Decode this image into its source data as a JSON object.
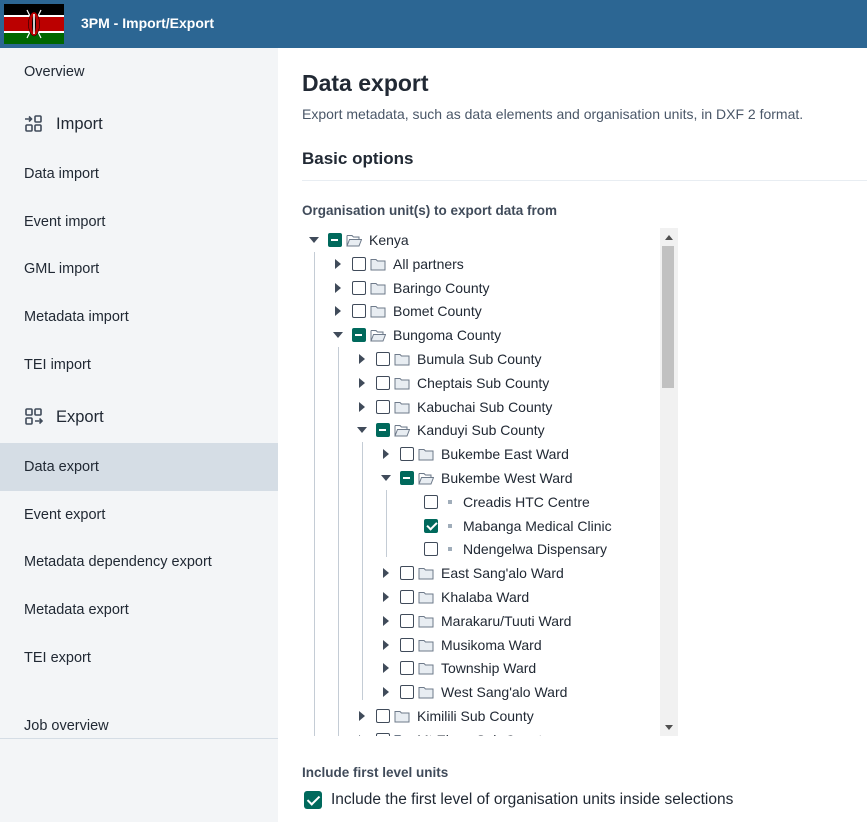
{
  "header": {
    "title": "3PM - Import/Export"
  },
  "sidebar": {
    "overview": "Overview",
    "import_section": "Import",
    "import_items": [
      "Data import",
      "Event import",
      "GML import",
      "Metadata import",
      "TEI import"
    ],
    "export_section": "Export",
    "export_items": [
      "Data export",
      "Event export",
      "Metadata dependency export",
      "Metadata export",
      "TEI export"
    ],
    "job_overview": "Job overview",
    "active_item": "Data export"
  },
  "main": {
    "title": "Data export",
    "description": "Export metadata, such as data elements and organisation units, in DXF 2 format.",
    "section_title": "Basic options",
    "org_unit_label": "Organisation unit(s) to export data from",
    "first_level_label": "Include first level units",
    "first_level_checkbox_label": "Include the first level of organisation units inside selections",
    "first_level_checked": true
  },
  "tree": [
    {
      "label": "Kenya",
      "level": 0,
      "expanded": true,
      "state": "partial",
      "type": "folder"
    },
    {
      "label": "All partners",
      "level": 1,
      "expanded": false,
      "state": "unchecked",
      "type": "folder"
    },
    {
      "label": "Baringo County",
      "level": 1,
      "expanded": false,
      "state": "unchecked",
      "type": "folder"
    },
    {
      "label": "Bomet County",
      "level": 1,
      "expanded": false,
      "state": "unchecked",
      "type": "folder"
    },
    {
      "label": "Bungoma County",
      "level": 1,
      "expanded": true,
      "state": "partial",
      "type": "folder"
    },
    {
      "label": "Bumula Sub County",
      "level": 2,
      "expanded": false,
      "state": "unchecked",
      "type": "folder"
    },
    {
      "label": "Cheptais Sub County",
      "level": 2,
      "expanded": false,
      "state": "unchecked",
      "type": "folder"
    },
    {
      "label": "Kabuchai Sub County",
      "level": 2,
      "expanded": false,
      "state": "unchecked",
      "type": "folder"
    },
    {
      "label": "Kanduyi Sub County",
      "level": 2,
      "expanded": true,
      "state": "partial",
      "type": "folder"
    },
    {
      "label": "Bukembe East Ward",
      "level": 3,
      "expanded": false,
      "state": "unchecked",
      "type": "folder"
    },
    {
      "label": "Bukembe West Ward",
      "level": 3,
      "expanded": true,
      "state": "partial",
      "type": "folder"
    },
    {
      "label": "Creadis HTC Centre",
      "level": 4,
      "state": "unchecked",
      "type": "leaf"
    },
    {
      "label": "Mabanga Medical Clinic",
      "level": 4,
      "state": "checked",
      "type": "leaf"
    },
    {
      "label": "Ndengelwa Dispensary",
      "level": 4,
      "state": "unchecked",
      "type": "leaf"
    },
    {
      "label": "East Sang'alo Ward",
      "level": 3,
      "expanded": false,
      "state": "unchecked",
      "type": "folder"
    },
    {
      "label": "Khalaba Ward",
      "level": 3,
      "expanded": false,
      "state": "unchecked",
      "type": "folder"
    },
    {
      "label": "Marakaru/Tuuti Ward",
      "level": 3,
      "expanded": false,
      "state": "unchecked",
      "type": "folder"
    },
    {
      "label": "Musikoma Ward",
      "level": 3,
      "expanded": false,
      "state": "unchecked",
      "type": "folder"
    },
    {
      "label": "Township Ward",
      "level": 3,
      "expanded": false,
      "state": "unchecked",
      "type": "folder"
    },
    {
      "label": "West Sang'alo Ward",
      "level": 3,
      "expanded": false,
      "state": "unchecked",
      "type": "folder"
    },
    {
      "label": "Kimilili Sub County",
      "level": 2,
      "expanded": false,
      "state": "unchecked",
      "type": "folder"
    },
    {
      "label": "Mt Elgon Sub County",
      "level": 2,
      "expanded": false,
      "state": "unchecked",
      "type": "folder"
    }
  ],
  "colors": {
    "header_bg": "#2c6693",
    "accent": "#00695c",
    "sidebar_bg": "#f3f5f7",
    "active_bg": "#d5dde5"
  }
}
